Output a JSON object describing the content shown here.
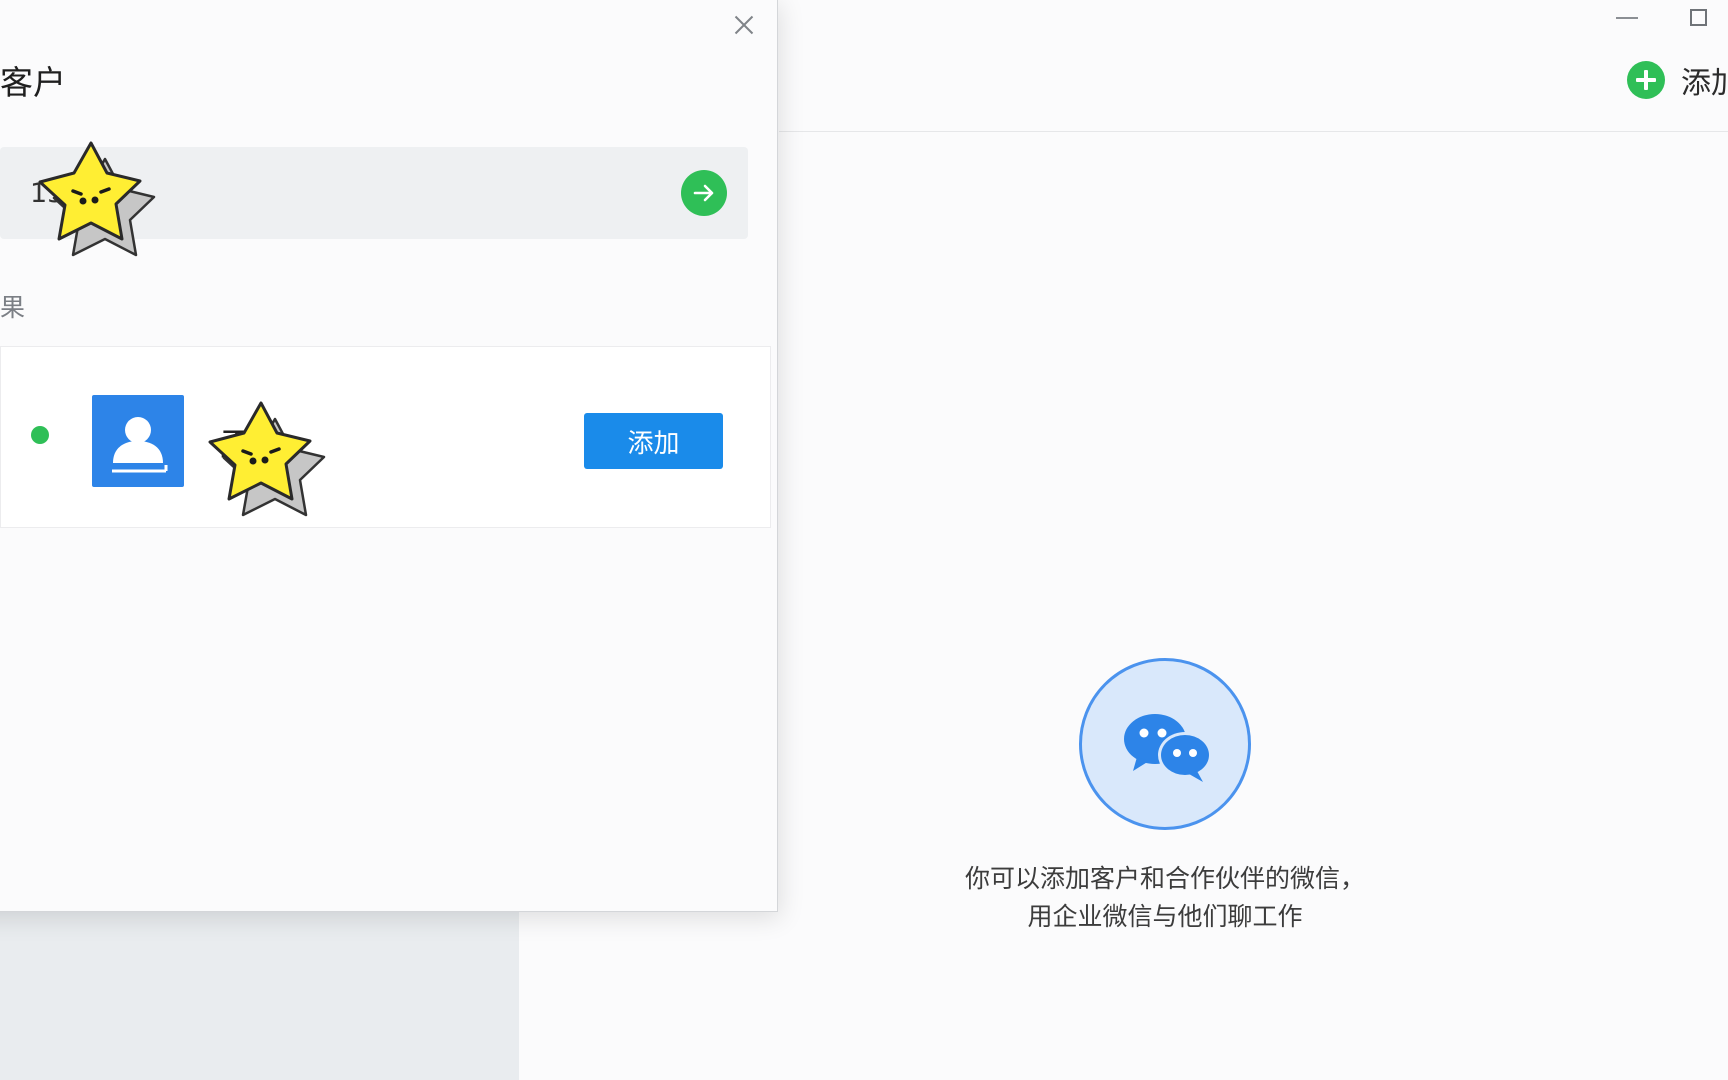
{
  "main_window": {
    "add_action_label": "添加",
    "empty_state_line1": "你可以添加客户和合作伙伴的微信，",
    "empty_state_line2": "用企业微信与他们聊工作"
  },
  "dialog": {
    "title": "客户",
    "search_value": "135",
    "result_label": "果",
    "result": {
      "name": "王",
      "add_label": "添加"
    }
  },
  "colors": {
    "green": "#2fbf57",
    "blue": "#1a8bea",
    "sticker_yellow": "#ffee33"
  },
  "icons": {
    "window_minimize": "minimize-icon",
    "window_maximize": "maximize-icon",
    "add": "plus-circle-icon",
    "close": "close-icon",
    "search_go": "arrow-right-icon",
    "avatar": "person-icon",
    "empty_state": "wechat-chat-icon",
    "sticker": "star-sticker-icon"
  }
}
